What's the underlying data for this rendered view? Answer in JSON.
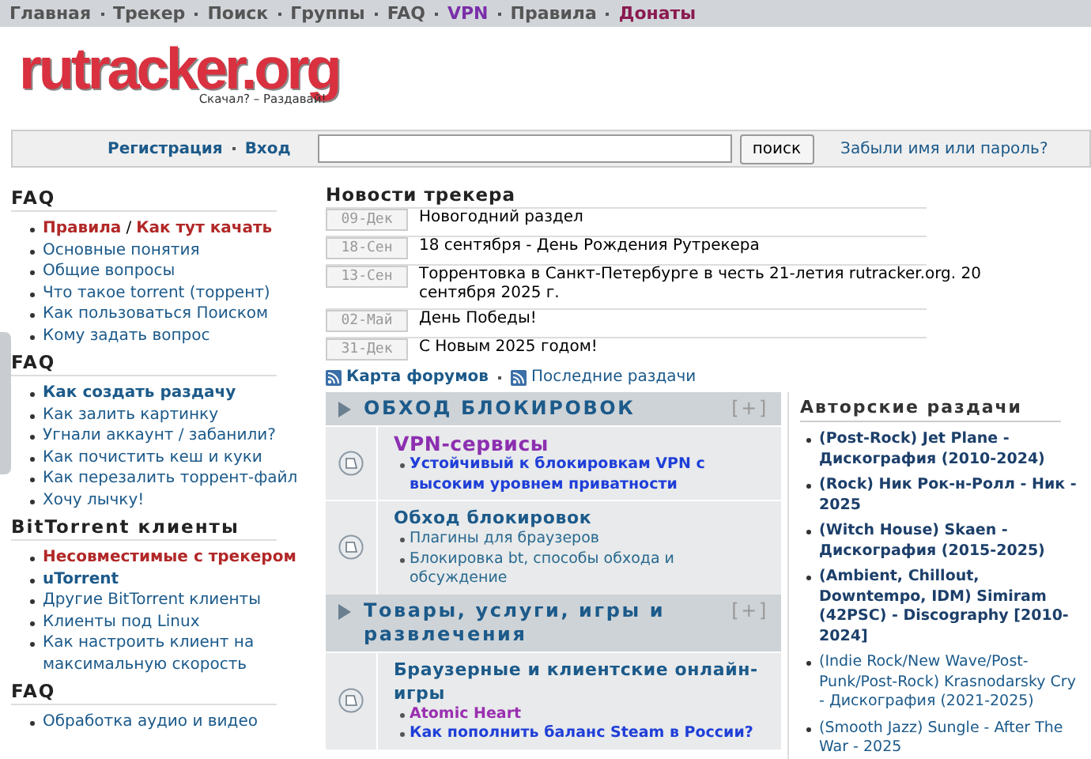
{
  "top_nav": [
    {
      "label": "Главная",
      "kind": "normal"
    },
    {
      "label": "Трекер",
      "kind": "normal"
    },
    {
      "label": "Поиск",
      "kind": "normal"
    },
    {
      "label": "Группы",
      "kind": "normal"
    },
    {
      "label": "FAQ",
      "kind": "normal"
    },
    {
      "label": "VPN",
      "kind": "vpn"
    },
    {
      "label": "Правила",
      "kind": "normal"
    },
    {
      "label": "Донаты",
      "kind": "donate"
    }
  ],
  "logo": {
    "text": "rutracker.org",
    "tagline": "Скачал? – Раздавай!"
  },
  "login_bar": {
    "links": [
      "Регистрация",
      "Вход"
    ],
    "search_button": "поиск",
    "forgot_link": "Забыли имя или пароль?"
  },
  "sidebar": [
    {
      "title": "FAQ",
      "items": [
        {
          "links": [
            {
              "text": "Правила",
              "kind": "red"
            },
            {
              "text": "Как тут качать",
              "kind": "red"
            }
          ],
          "separator": "/"
        },
        {
          "links": [
            {
              "text": "Основные понятия",
              "kind": "normal"
            }
          ]
        },
        {
          "links": [
            {
              "text": "Общие вопросы",
              "kind": "normal"
            }
          ]
        },
        {
          "links": [
            {
              "text": "Что такое torrent (торрент)",
              "kind": "normal"
            }
          ]
        },
        {
          "links": [
            {
              "text": "Как пользоваться Поиском",
              "kind": "normal"
            }
          ]
        },
        {
          "links": [
            {
              "text": "Кому задать вопрос",
              "kind": "normal"
            }
          ]
        }
      ]
    },
    {
      "title": "FAQ",
      "items": [
        {
          "links": [
            {
              "text": "Как создать раздачу",
              "kind": "bold"
            }
          ]
        },
        {
          "links": [
            {
              "text": "Как залить картинку",
              "kind": "normal"
            }
          ]
        },
        {
          "links": [
            {
              "text": "Угнали аккаунт / забанили?",
              "kind": "normal"
            }
          ]
        },
        {
          "links": [
            {
              "text": "Как почистить кеш и куки",
              "kind": "normal"
            }
          ]
        },
        {
          "links": [
            {
              "text": "Как перезалить торрент-файл",
              "kind": "normal"
            }
          ]
        },
        {
          "links": [
            {
              "text": "Хочу лычку!",
              "kind": "normal"
            }
          ]
        }
      ]
    },
    {
      "title": "BitTorrent клиенты",
      "items": [
        {
          "links": [
            {
              "text": "Несовместимые с трекером",
              "kind": "red"
            }
          ]
        },
        {
          "links": [
            {
              "text": "uTorrent",
              "kind": "bold"
            }
          ]
        },
        {
          "links": [
            {
              "text": "Другие BitTorrent клиенты",
              "kind": "normal"
            }
          ]
        },
        {
          "links": [
            {
              "text": "Клиенты под Linux",
              "kind": "normal"
            }
          ]
        },
        {
          "links": [
            {
              "text": "Как настроить клиент на максимальную скорость",
              "kind": "normal"
            }
          ]
        }
      ]
    },
    {
      "title": "FAQ",
      "items": [
        {
          "links": [
            {
              "text": "Обработка аудио и видео",
              "kind": "normal"
            }
          ]
        }
      ]
    }
  ],
  "news": {
    "title": "Новости трекера",
    "items": [
      {
        "date": "09-Дек",
        "text": "Новогодний раздел"
      },
      {
        "date": "18-Сен",
        "text": "18 сентября - День Рождения Рутрекера"
      },
      {
        "date": "13-Сен",
        "text": "Торрентовка в Санкт-Петербурге в честь 21-летия rutracker.org. 20 сентября 2025 г."
      },
      {
        "date": "02-Май",
        "text": "День Победы!"
      },
      {
        "date": "31-Дек",
        "text": "С Новым 2025 годом!"
      }
    ]
  },
  "feed_links": [
    {
      "label": "Карта форумов",
      "bold": true
    },
    {
      "label": "Последние раздачи",
      "bold": false
    }
  ],
  "categories": [
    {
      "title": "ОБХОД БЛОКИРОВОК",
      "toggle": "[+]",
      "forums": [
        {
          "title": "VPN-сервисы",
          "kind": "vpn",
          "subforums": [
            {
              "text": "Устойчивый к блокировкам VPN с высоким уровнем приватности",
              "kind": "bold"
            }
          ]
        },
        {
          "title": "Обход блокировок",
          "kind": "normal",
          "subforums": [
            {
              "text": "Плагины для браузеров",
              "kind": "normal"
            },
            {
              "text": "Блокировка bt, способы обхода и обсуждение",
              "kind": "normal"
            }
          ]
        }
      ]
    },
    {
      "title": "Товары, услуги, игры и развлечения",
      "toggle": "[+]",
      "forums": [
        {
          "title": "Браузерные и клиентские онлайн-игры",
          "kind": "normal",
          "subforums": [
            {
              "text": "Atomic Heart",
              "kind": "purple"
            },
            {
              "text": "Как пополнить баланс Steam в России?",
              "kind": "bold"
            }
          ]
        }
      ]
    }
  ],
  "author_releases": {
    "title": "Авторские раздачи",
    "items": [
      {
        "text": "(Post-Rock) Jet Plane - Дискография (2010-2024)",
        "bold": true
      },
      {
        "text": "(Rock) Ник Рок-н-Ролл - Ник - 2025",
        "bold": true
      },
      {
        "text": "(Witch House) Skaen - Дискография (2015-2025)",
        "bold": true
      },
      {
        "text": "(Ambient, Chillout, Downtempo, IDM) Simiram (42PSC) - Discography [2010-2024]",
        "bold": true
      },
      {
        "text": "(Indie Rock/New Wave/Post-Punk/Post-Rock) Krasnodarsky Cry - Дискография (2021-2025)",
        "bold": false
      },
      {
        "text": "(Smooth Jazz) Sungle - After The War - 2025",
        "bold": false
      }
    ]
  }
}
